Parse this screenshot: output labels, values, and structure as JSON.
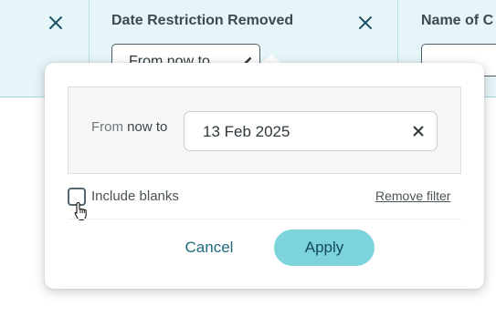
{
  "filter_bar": {
    "columns": [
      {
        "title": "Date Restriction Removed",
        "chip_text": "From now to"
      },
      {
        "title": "Name of C",
        "chip_text": ""
      }
    ]
  },
  "popover": {
    "range_label_prefix": "From",
    "range_label_suffix": "now to",
    "date_value": "13 Feb 2025",
    "include_blanks_label": "Include blanks",
    "include_blanks_checked": false,
    "remove_filter_label": "Remove filter",
    "cancel_label": "Cancel",
    "apply_label": "Apply"
  },
  "colors": {
    "bar_background": "#e6f5f8",
    "accent": "#7dd3dc",
    "link": "#1f6a7c",
    "icon": "#1f5466"
  }
}
